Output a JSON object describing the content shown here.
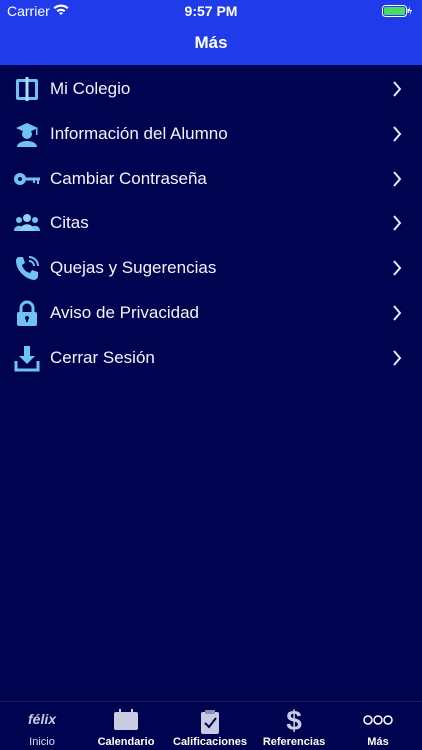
{
  "status_bar": {
    "carrier": "Carrier",
    "time": "9:57 PM"
  },
  "header": {
    "title": "Más"
  },
  "menu": {
    "items": [
      {
        "label": "Mi Colegio",
        "icon": "school-book-icon"
      },
      {
        "label": "Información del Alumno",
        "icon": "graduate-icon"
      },
      {
        "label": "Cambiar Contraseña",
        "icon": "key-icon"
      },
      {
        "label": "Citas",
        "icon": "people-group-icon"
      },
      {
        "label": "Quejas y Sugerencias",
        "icon": "phone-call-icon"
      },
      {
        "label": "Aviso de Privacidad",
        "icon": "padlock-icon"
      },
      {
        "label": "Cerrar Sesión",
        "icon": "download-logout-icon"
      }
    ]
  },
  "tabbar": {
    "tabs": [
      {
        "label": "Inicio",
        "logo_text": "félix"
      },
      {
        "label": "Calendario"
      },
      {
        "label": "Calificaciones"
      },
      {
        "label": "Referencias"
      },
      {
        "label": "Más"
      }
    ]
  },
  "colors": {
    "header": "#1f3bea",
    "background": "#00034f",
    "icon": "#6fc3f0"
  }
}
